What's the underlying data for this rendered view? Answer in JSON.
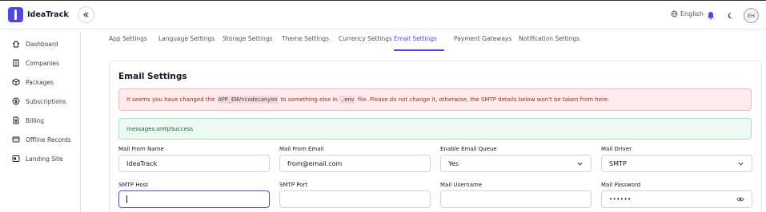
{
  "app": {
    "name": "IdeaTrack"
  },
  "header": {
    "language": "English",
    "avatar_initials": "EH",
    "icons": [
      "globe-icon",
      "bell-icon",
      "moon-icon",
      "chevrons-left-icon"
    ]
  },
  "sidebar": {
    "items": [
      {
        "label": "Dashboard",
        "icon": "home-icon"
      },
      {
        "label": "Companies",
        "icon": "building-icon"
      },
      {
        "label": "Packages",
        "icon": "box-icon"
      },
      {
        "label": "Subscriptions",
        "icon": "dollar-icon"
      },
      {
        "label": "Billing",
        "icon": "document-icon"
      },
      {
        "label": "Offline Records",
        "icon": "offline-icon"
      },
      {
        "label": "Landing Site",
        "icon": "site-icon"
      }
    ]
  },
  "tabs": [
    {
      "label": "App Settings",
      "active": false
    },
    {
      "label": "Language Settings",
      "active": false
    },
    {
      "label": "Storage Settings",
      "active": false
    },
    {
      "label": "Theme Settings",
      "active": false
    },
    {
      "label": "Currency Settings",
      "active": false
    },
    {
      "label": "Email Settings",
      "active": true
    },
    {
      "label": "Payment Gateways",
      "active": false
    },
    {
      "label": "Notification Settings",
      "active": false
    }
  ],
  "email": {
    "title": "Email Settings",
    "danger_before": "It seems you have changed the ",
    "danger_code1": "APP_ENV=codecanyon",
    "danger_middle": " to something else in ",
    "danger_code2": ".env",
    "danger_after": " file. Please do not change it, otherwise, the SMTP details below won't be taken from here.",
    "success": "messages.smtpSuccess",
    "fields": {
      "mail_from_name": {
        "label": "Mail From Name",
        "value": "IdeaTrack"
      },
      "mail_from_email": {
        "label": "Mail From Email",
        "value": "from@email.com"
      },
      "enable_email_queue": {
        "label": "Enable Email Queue",
        "value": "Yes"
      },
      "mail_driver": {
        "label": "Mail Driver",
        "value": "SMTP"
      },
      "smtp_host": {
        "label": "SMTP Host",
        "value": ""
      },
      "smtp_port": {
        "label": "SMTP Port",
        "value": ""
      },
      "mail_username": {
        "label": "Mail Username",
        "value": ""
      },
      "mail_password": {
        "label": "Mail Password",
        "value": "••••••"
      }
    }
  },
  "colors": {
    "accent": "#4f46e5",
    "danger_bg": "#fdecee",
    "danger_text": "#b42318",
    "success_bg": "#ecf8f1",
    "success_text": "#166534"
  }
}
